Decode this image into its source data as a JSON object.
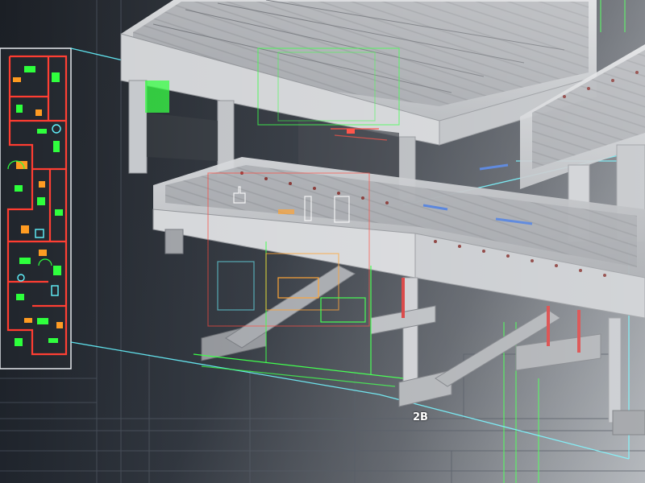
{
  "annotations": {
    "section_marker": "2B"
  },
  "colors": {
    "background_dark": "#1c2026",
    "background_light": "#9ea3a9",
    "cad_green": "#2bff3a",
    "cad_red": "#ff3b2f",
    "cad_orange": "#ff9a1f",
    "cad_cyan": "#5ff4ff",
    "concrete": "#c9cbcf",
    "steel_column": "#d42a2a"
  },
  "icons": [
    "floor-plan-drawing",
    "structure-model-3d",
    "projection-lines"
  ]
}
